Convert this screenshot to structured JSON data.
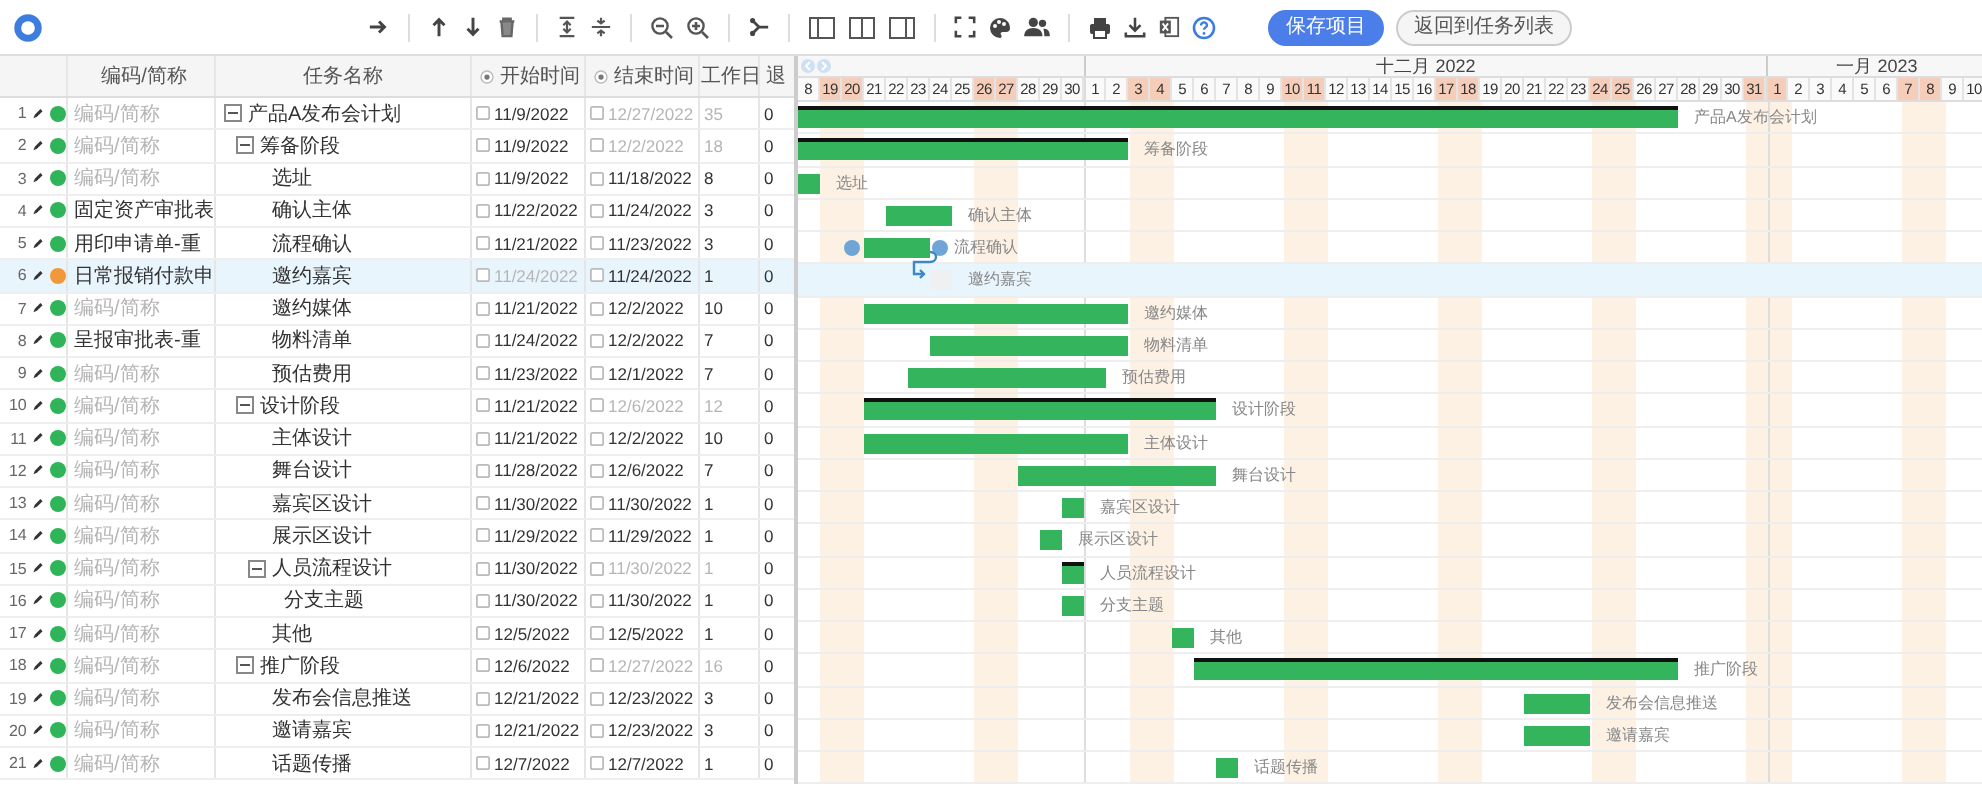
{
  "toolbar": {
    "buttons": [
      {
        "label": "保存项目",
        "kind": "primary"
      },
      {
        "label": "返回到任务列表",
        "kind": "secondary"
      }
    ]
  },
  "grid": {
    "columns": [
      "编码/简称",
      "任务名称",
      "开始时间",
      "结束时间",
      "工作日",
      "退"
    ]
  },
  "timeline": {
    "months": [
      {
        "days": [
          {
            "label": "8",
            "weekend": false
          },
          {
            "label": "19",
            "weekend": true
          },
          {
            "label": "20",
            "weekend": true
          },
          {
            "label": "21",
            "weekend": false
          },
          {
            "label": "22",
            "weekend": false
          },
          {
            "label": "23",
            "weekend": false
          },
          {
            "label": "24",
            "weekend": false
          },
          {
            "label": "25",
            "weekend": false
          },
          {
            "label": "26",
            "weekend": true
          },
          {
            "label": "27",
            "weekend": true
          },
          {
            "label": "28",
            "weekend": false
          },
          {
            "label": "29",
            "weekend": false
          },
          {
            "label": "30",
            "weekend": false
          }
        ]
      },
      {
        "label": "十二月 2022",
        "days": [
          {
            "label": "1",
            "weekend": false
          },
          {
            "label": "2",
            "weekend": false
          },
          {
            "label": "3",
            "weekend": true
          },
          {
            "label": "4",
            "weekend": true
          },
          {
            "label": "5",
            "weekend": false
          },
          {
            "label": "6",
            "weekend": false
          },
          {
            "label": "7",
            "weekend": false
          },
          {
            "label": "8",
            "weekend": false
          },
          {
            "label": "9",
            "weekend": false
          },
          {
            "label": "10",
            "weekend": true
          },
          {
            "label": "11",
            "weekend": true
          },
          {
            "label": "12",
            "weekend": false
          },
          {
            "label": "13",
            "weekend": false
          },
          {
            "label": "14",
            "weekend": false
          },
          {
            "label": "15",
            "weekend": false
          },
          {
            "label": "16",
            "weekend": false
          },
          {
            "label": "17",
            "weekend": true
          },
          {
            "label": "18",
            "weekend": true
          },
          {
            "label": "19",
            "weekend": false
          },
          {
            "label": "20",
            "weekend": false
          },
          {
            "label": "21",
            "weekend": false
          },
          {
            "label": "22",
            "weekend": false
          },
          {
            "label": "23",
            "weekend": false
          },
          {
            "label": "24",
            "weekend": true
          },
          {
            "label": "25",
            "weekend": true
          },
          {
            "label": "26",
            "weekend": false
          },
          {
            "label": "27",
            "weekend": false
          },
          {
            "label": "28",
            "weekend": false
          },
          {
            "label": "29",
            "weekend": false
          },
          {
            "label": "30",
            "weekend": false
          },
          {
            "label": "31",
            "weekend": true
          }
        ]
      },
      {
        "label": "一月 2023",
        "days": [
          {
            "label": "1",
            "weekend": true
          },
          {
            "label": "2",
            "weekend": false
          },
          {
            "label": "3",
            "weekend": false
          },
          {
            "label": "4",
            "weekend": false
          },
          {
            "label": "5",
            "weekend": false
          },
          {
            "label": "6",
            "weekend": false
          },
          {
            "label": "7",
            "weekend": true
          },
          {
            "label": "8",
            "weekend": true
          },
          {
            "label": "9",
            "weekend": false
          },
          {
            "label": "10",
            "weekend": false
          }
        ]
      }
    ]
  },
  "tasks": [
    {
      "number": "1",
      "code": "编码/简称",
      "code_muted": true,
      "color": "#2fb45a",
      "name": "产品A发布会计划",
      "start": "11/9/2022",
      "start_muted": false,
      "end": "12/27/2022",
      "end_muted": true,
      "workdays": "35",
      "column_7": "0",
      "kind": "summary",
      "expanded": true,
      "selected": false,
      "link_handles": false,
      "bar_label": "产品A发布会计划",
      "children": [
        {
          "number": "2",
          "code": "编码/简称",
          "code_muted": true,
          "color": "#2fb45a",
          "name": "筹备阶段",
          "start": "11/9/2022",
          "start_muted": false,
          "end": "12/2/2022",
          "end_muted": true,
          "workdays": "18",
          "column_7": "0",
          "kind": "summary",
          "expanded": true,
          "selected": false,
          "link_handles": false,
          "bar_label": "筹备阶段",
          "children": [
            {
              "number": "3",
              "code": "编码/简称",
              "code_muted": true,
              "color": "#2fb45a",
              "name": "选址",
              "start": "11/9/2022",
              "start_muted": false,
              "end": "11/18/2022",
              "end_muted": false,
              "workdays": "8",
              "column_7": "0",
              "kind": "task",
              "selected": false,
              "link_handles": false,
              "bar_label": "选址"
            },
            {
              "number": "4",
              "code": "固定资产审批表",
              "code_muted": false,
              "color": "#2fb45a",
              "name": "确认主体",
              "start": "11/22/2022",
              "start_muted": false,
              "end": "11/24/2022",
              "end_muted": false,
              "workdays": "3",
              "column_7": "0",
              "kind": "task",
              "selected": false,
              "link_handles": false,
              "bar_label": "确认主体"
            },
            {
              "number": "5",
              "code": "用印申请单-重",
              "code_muted": false,
              "color": "#2fb45a",
              "name": "流程确认",
              "start": "11/21/2022",
              "start_muted": false,
              "end": "11/23/2022",
              "end_muted": false,
              "workdays": "3",
              "column_7": "0",
              "kind": "task",
              "selected": false,
              "link_handles": true,
              "bar_label": "流程确认"
            },
            {
              "number": "6",
              "code": "日常报销付款申",
              "code_muted": false,
              "color": "#f0983a",
              "name": "邀约嘉宾",
              "start": "11/24/2022",
              "start_muted": true,
              "end": "11/24/2022",
              "end_muted": false,
              "workdays": "1",
              "column_7": "0",
              "kind": "ghost",
              "selected": true,
              "link_handles": false,
              "bar_label": "邀约嘉宾"
            },
            {
              "number": "7",
              "code": "编码/简称",
              "code_muted": true,
              "color": "#2fb45a",
              "name": "邀约媒体",
              "start": "11/21/2022",
              "start_muted": false,
              "end": "12/2/2022",
              "end_muted": false,
              "workdays": "10",
              "column_7": "0",
              "kind": "task",
              "selected": false,
              "link_handles": false,
              "bar_label": "邀约媒体"
            },
            {
              "number": "8",
              "code": "呈报审批表-重",
              "code_muted": false,
              "color": "#2fb45a",
              "name": "物料清单",
              "start": "11/24/2022",
              "start_muted": false,
              "end": "12/2/2022",
              "end_muted": false,
              "workdays": "7",
              "column_7": "0",
              "kind": "task",
              "selected": false,
              "link_handles": false,
              "bar_label": "物料清单"
            },
            {
              "number": "9",
              "code": "编码/简称",
              "code_muted": true,
              "color": "#2fb45a",
              "name": "预估费用",
              "start": "11/23/2022",
              "start_muted": false,
              "end": "12/1/2022",
              "end_muted": false,
              "workdays": "7",
              "column_7": "0",
              "kind": "task",
              "selected": false,
              "link_handles": false,
              "bar_label": "预估费用"
            }
          ]
        },
        {
          "number": "10",
          "code": "编码/简称",
          "code_muted": true,
          "color": "#2fb45a",
          "name": "设计阶段",
          "start": "11/21/2022",
          "start_muted": false,
          "end": "12/6/2022",
          "end_muted": true,
          "workdays": "12",
          "column_7": "0",
          "kind": "summary",
          "expanded": true,
          "selected": false,
          "link_handles": false,
          "bar_label": "设计阶段",
          "children": [
            {
              "number": "11",
              "code": "编码/简称",
              "code_muted": true,
              "color": "#2fb45a",
              "name": "主体设计",
              "start": "11/21/2022",
              "start_muted": false,
              "end": "12/2/2022",
              "end_muted": false,
              "workdays": "10",
              "column_7": "0",
              "kind": "task",
              "selected": false,
              "link_handles": false,
              "bar_label": "主体设计"
            },
            {
              "number": "12",
              "code": "编码/简称",
              "code_muted": true,
              "color": "#2fb45a",
              "name": "舞台设计",
              "start": "11/28/2022",
              "start_muted": false,
              "end": "12/6/2022",
              "end_muted": false,
              "workdays": "7",
              "column_7": "0",
              "kind": "task",
              "selected": false,
              "link_handles": false,
              "bar_label": "舞台设计"
            },
            {
              "number": "13",
              "code": "编码/简称",
              "code_muted": true,
              "color": "#2fb45a",
              "name": "嘉宾区设计",
              "start": "11/30/2022",
              "start_muted": false,
              "end": "11/30/2022",
              "end_muted": false,
              "workdays": "1",
              "column_7": "0",
              "kind": "task",
              "selected": false,
              "link_handles": false,
              "bar_label": "嘉宾区设计"
            },
            {
              "number": "14",
              "code": "编码/简称",
              "code_muted": true,
              "color": "#2fb45a",
              "name": "展示区设计",
              "start": "11/29/2022",
              "start_muted": false,
              "end": "11/29/2022",
              "end_muted": false,
              "workdays": "1",
              "column_7": "0",
              "kind": "task",
              "selected": false,
              "link_handles": false,
              "bar_label": "展示区设计"
            },
            {
              "number": "15",
              "code": "编码/简称",
              "code_muted": true,
              "color": "#2fb45a",
              "name": "人员流程设计",
              "start": "11/30/2022",
              "start_muted": false,
              "end": "11/30/2022",
              "end_muted": true,
              "workdays": "1",
              "column_7": "0",
              "kind": "summary",
              "expanded": true,
              "selected": false,
              "link_handles": false,
              "bar_label": "人员流程设计",
              "children": [
                {
                  "number": "16",
                  "code": "编码/简称",
                  "code_muted": true,
                  "color": "#2fb45a",
                  "name": "分支主题",
                  "start": "11/30/2022",
                  "start_muted": false,
                  "end": "11/30/2022",
                  "end_muted": false,
                  "workdays": "1",
                  "column_7": "0",
                  "kind": "task",
                  "selected": false,
                  "link_handles": false,
                  "bar_label": "分支主题"
                }
              ]
            },
            {
              "number": "17",
              "code": "编码/简称",
              "code_muted": true,
              "color": "#2fb45a",
              "name": "其他",
              "start": "12/5/2022",
              "start_muted": false,
              "end": "12/5/2022",
              "end_muted": false,
              "workdays": "1",
              "column_7": "0",
              "kind": "task",
              "selected": false,
              "link_handles": false,
              "bar_label": "其他"
            }
          ]
        },
        {
          "number": "18",
          "code": "编码/简称",
          "code_muted": true,
          "color": "#2fb45a",
          "name": "推广阶段",
          "start": "12/6/2022",
          "start_muted": false,
          "end": "12/27/2022",
          "end_muted": true,
          "workdays": "16",
          "column_7": "0",
          "kind": "summary",
          "expanded": true,
          "selected": false,
          "link_handles": false,
          "bar_label": "推广阶段",
          "children": [
            {
              "number": "19",
              "code": "编码/简称",
              "code_muted": true,
              "color": "#2fb45a",
              "name": "发布会信息推送",
              "start": "12/21/2022",
              "start_muted": false,
              "end": "12/23/2022",
              "end_muted": false,
              "workdays": "3",
              "column_7": "0",
              "kind": "task",
              "selected": false,
              "link_handles": false,
              "bar_label": "发布会信息推送"
            },
            {
              "number": "20",
              "code": "编码/简称",
              "code_muted": true,
              "color": "#2fb45a",
              "name": "邀请嘉宾",
              "start": "12/21/2022",
              "start_muted": false,
              "end": "12/23/2022",
              "end_muted": false,
              "workdays": "3",
              "column_7": "0",
              "kind": "task",
              "selected": false,
              "link_handles": false,
              "bar_label": "邀请嘉宾"
            },
            {
              "number": "21",
              "code": "编码/简称",
              "code_muted": true,
              "color": "#2fb45a",
              "name": "话题传播",
              "start": "12/7/2022",
              "start_muted": false,
              "end": "12/7/2022",
              "end_muted": false,
              "workdays": "1",
              "column_7": "0",
              "kind": "task",
              "selected": false,
              "link_handles": false,
              "bar_label": "话题传播"
            }
          ]
        }
      ]
    }
  ]
}
